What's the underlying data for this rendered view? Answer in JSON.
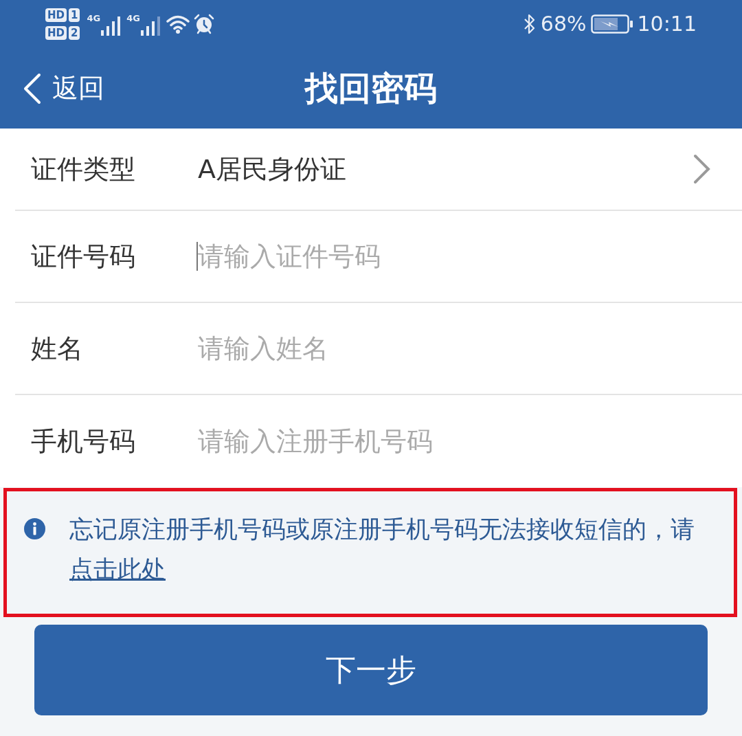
{
  "status_bar": {
    "sim_cards": [
      {
        "label": "HD",
        "slot": "1"
      },
      {
        "label": "HD",
        "slot": "2"
      }
    ],
    "networks": [
      {
        "type": "4G"
      },
      {
        "type": "4G"
      }
    ],
    "battery_percent": "68%",
    "time": "10:11"
  },
  "nav": {
    "back": "返回",
    "title": "找回密码"
  },
  "form": {
    "rows": [
      {
        "kind": "select",
        "label": "证件类型",
        "value": "A居民身份证"
      },
      {
        "kind": "input",
        "label": "证件号码",
        "placeholder": "请输入证件号码",
        "focused": true
      },
      {
        "kind": "input",
        "label": "姓名",
        "placeholder": "请输入姓名",
        "focused": false
      },
      {
        "kind": "input",
        "label": "手机号码",
        "placeholder": "请输入注册手机号码",
        "focused": false
      }
    ]
  },
  "notice": {
    "highlighted": true,
    "text": "忘记原注册手机号码或原注册手机号码无法接收短信的，请",
    "link": "点击此处"
  },
  "button": "下一步"
}
